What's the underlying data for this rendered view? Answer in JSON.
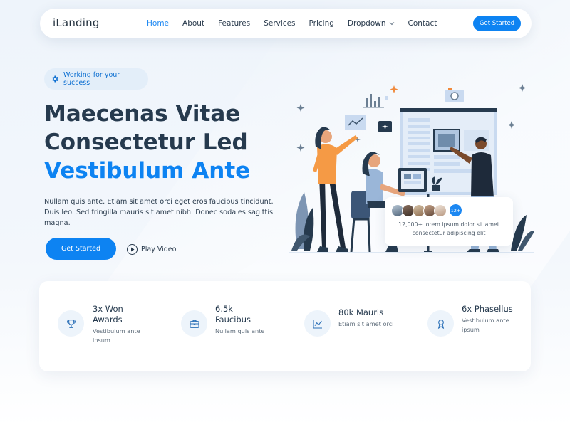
{
  "nav": {
    "logo": "iLanding",
    "links": [
      {
        "label": "Home"
      },
      {
        "label": "About"
      },
      {
        "label": "Features"
      },
      {
        "label": "Services"
      },
      {
        "label": "Pricing"
      },
      {
        "label": "Dropdown"
      },
      {
        "label": "Contact"
      }
    ],
    "cta": "Get Started"
  },
  "hero": {
    "badge": "Working for your success",
    "title_line1": "Maecenas Vitae",
    "title_line2": "Consectetur Led",
    "title_line3": "Vestibulum Ante",
    "description": "Nullam quis ante. Etiam sit amet orci eget eros faucibus tincidunt. Duis leo. Sed fringilla mauris sit amet nibh. Donec sodales sagittis magna.",
    "primary_button": "Get Started",
    "video_button": "Play Video"
  },
  "customers_card": {
    "count_badge": "12+",
    "text": "12,000+ lorem ipsum dolor sit amet consectetur adipiscing elit"
  },
  "stats": [
    {
      "title": "3x Won Awards",
      "subtitle": "Vestibulum ante ipsum",
      "icon": "trophy-icon"
    },
    {
      "title": "6.5k Faucibus",
      "subtitle": "Nullam quis ante",
      "icon": "briefcase-icon"
    },
    {
      "title": "80k Mauris",
      "subtitle": "Etiam sit amet orci",
      "icon": "chart-icon"
    },
    {
      "title": "6x Phasellus",
      "subtitle": "Vestibulum ante ipsum",
      "icon": "award-icon"
    }
  ],
  "colors": {
    "accent": "#0d83f2",
    "heading": "#263a4e",
    "background": "#eef4fb"
  }
}
